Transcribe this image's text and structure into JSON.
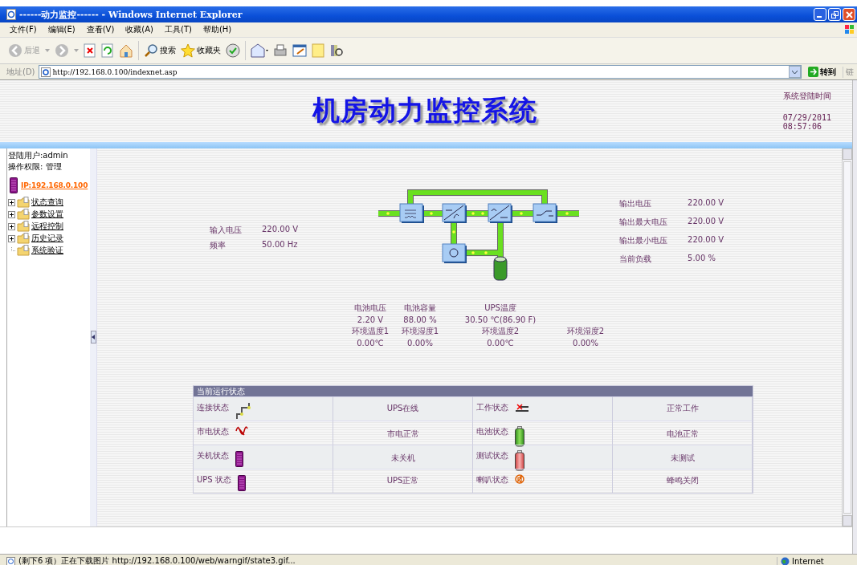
{
  "window": {
    "title": "------动力监控------ - Windows Internet Explorer"
  },
  "menu": [
    "文件(F)",
    "编辑(E)",
    "查看(V)",
    "收藏(A)",
    "工具(T)",
    "帮助(H)"
  ],
  "toolbar": {
    "back": "后退",
    "search": "搜索",
    "favorites": "收藏夹"
  },
  "address": {
    "label": "地址(D)",
    "url": "http://192.168.0.100/indexnet.asp",
    "go": "转到",
    "links": "链"
  },
  "header": {
    "title": "机房动力监控系统",
    "login_label": "系统登陆时间",
    "date": "07/29/2011",
    "time": "08:57:06"
  },
  "sidebar": {
    "user": "登陆用户:admin",
    "permission": "操作权限: 管理",
    "ip": "IP:192.168.0.100",
    "items": [
      {
        "label": "状态查询",
        "expandable": true
      },
      {
        "label": "参数设置",
        "expandable": true
      },
      {
        "label": "远程控制",
        "expandable": true
      },
      {
        "label": "历史记录",
        "expandable": true
      },
      {
        "label": "系统验证",
        "expandable": false
      }
    ]
  },
  "input": [
    {
      "label": "输入电压",
      "value": "220.00 V"
    },
    {
      "label": "频率",
      "value": "50.00 Hz"
    }
  ],
  "output": [
    {
      "label": "输出电压",
      "value": "220.00 V"
    },
    {
      "label": "输出最大电压",
      "value": "220.00 V"
    },
    {
      "label": "输出最小电压",
      "value": "220.00 V"
    },
    {
      "label": "当前负载",
      "value": "5.00 %"
    }
  ],
  "sensors": [
    [
      {
        "label": "电池电压",
        "value": "2.20 V"
      },
      {
        "label": "电池容量",
        "value": "88.00 %"
      },
      {
        "label": "UPS温度",
        "value": "30.50 ℃(86.90 F)"
      }
    ],
    [
      {
        "label": "环境温度1",
        "value": "0.00℃"
      },
      {
        "label": "环境湿度1",
        "value": "0.00%"
      },
      {
        "label": "环境温度2",
        "value": "0.00℃"
      },
      {
        "label": "环境湿度2",
        "value": "0.00%"
      }
    ]
  ],
  "status_table": {
    "title": "当前运行状态",
    "rows": [
      [
        {
          "label": "连接状态",
          "kind": "connection",
          "value": "UPS在线"
        },
        {
          "label": "工作状态",
          "kind": "work",
          "value": "正常工作"
        }
      ],
      [
        {
          "label": "市电状态",
          "kind": "mains",
          "value": "市电正常"
        },
        {
          "label": "电池状态",
          "kind": "battery_ok",
          "value": "电池正常"
        }
      ],
      [
        {
          "label": "关机状态",
          "kind": "device",
          "value": "未关机"
        },
        {
          "label": "测试状态",
          "kind": "battery_test",
          "value": "未测试"
        }
      ],
      [
        {
          "label": "UPS 状态",
          "kind": "device",
          "value": "UPS正常"
        },
        {
          "label": "喇叭状态",
          "kind": "buzzer",
          "value": "蜂鸣关闭"
        }
      ]
    ]
  },
  "status_bar": {
    "message": "(剩下6 项）正在下载图片 http://192.168.0.100/web/warngif/state3.gif...",
    "zone": "Internet"
  }
}
